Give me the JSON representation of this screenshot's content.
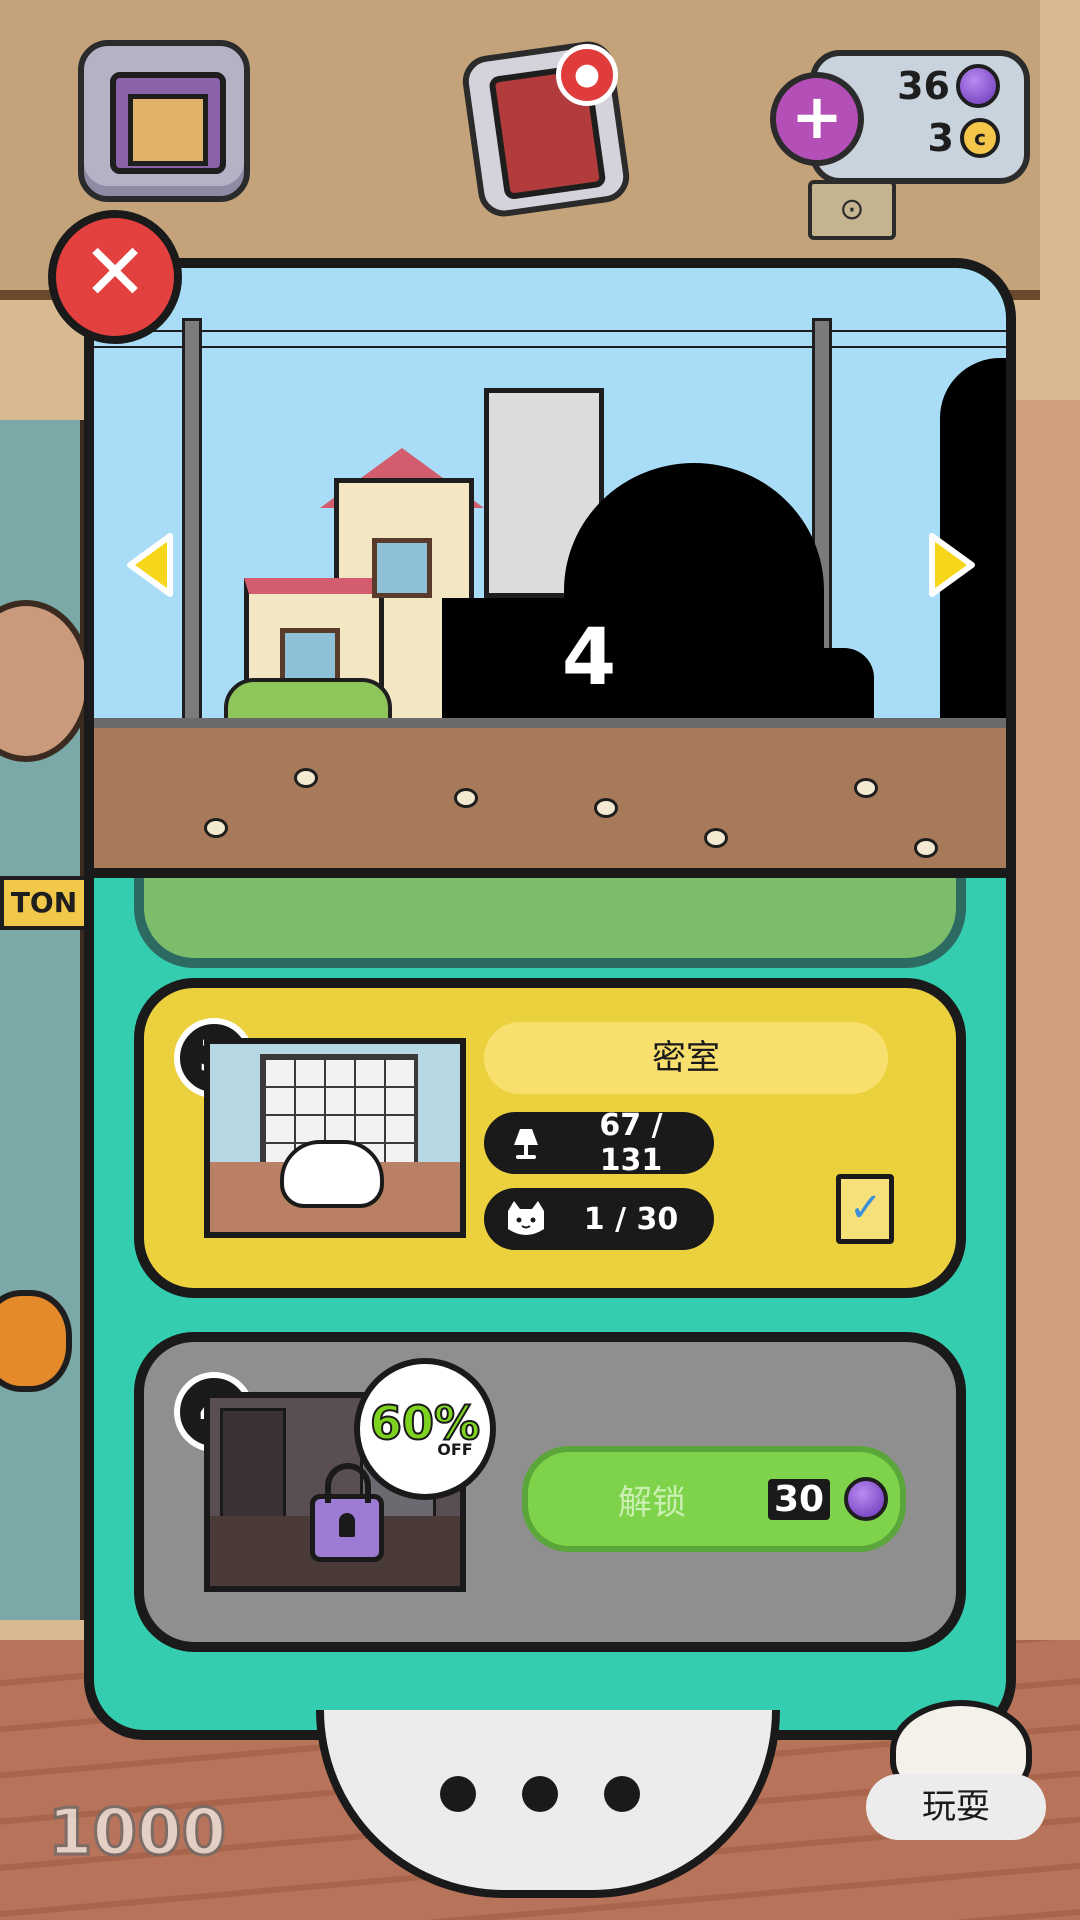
{
  "hud": {
    "gems": "36",
    "coins": "3",
    "plus_symbol": "+",
    "book_badge": "●",
    "coin_symbol": "c"
  },
  "close_symbol": "✕",
  "scene": {
    "locked_level_number": "4"
  },
  "background": {
    "sign_text": "TON"
  },
  "rooms": [
    {
      "number": "3",
      "name": "密室",
      "furniture_progress": "67 / 131",
      "cats_progress": "1 / 30"
    },
    {
      "number": "4",
      "sale_percent": "60%",
      "sale_off": "OFF",
      "unlock_label": "解锁",
      "unlock_price": "30"
    }
  ],
  "bottom": {
    "coins_display": "1000",
    "play_label": "玩耍"
  },
  "icons": {
    "gem": "gem-icon",
    "coin": "coin-icon",
    "lamp": "lamp-icon",
    "cat": "cat-face-icon",
    "checklist": "checklist-icon",
    "padlock": "padlock-icon"
  },
  "colors": {
    "panel": "#35cdb0",
    "card_active": "#ecd13f",
    "card_locked": "#8f8f8f",
    "unlock_button": "#7ed34a",
    "close_button": "#e34040",
    "gem": "#7b45c7"
  }
}
